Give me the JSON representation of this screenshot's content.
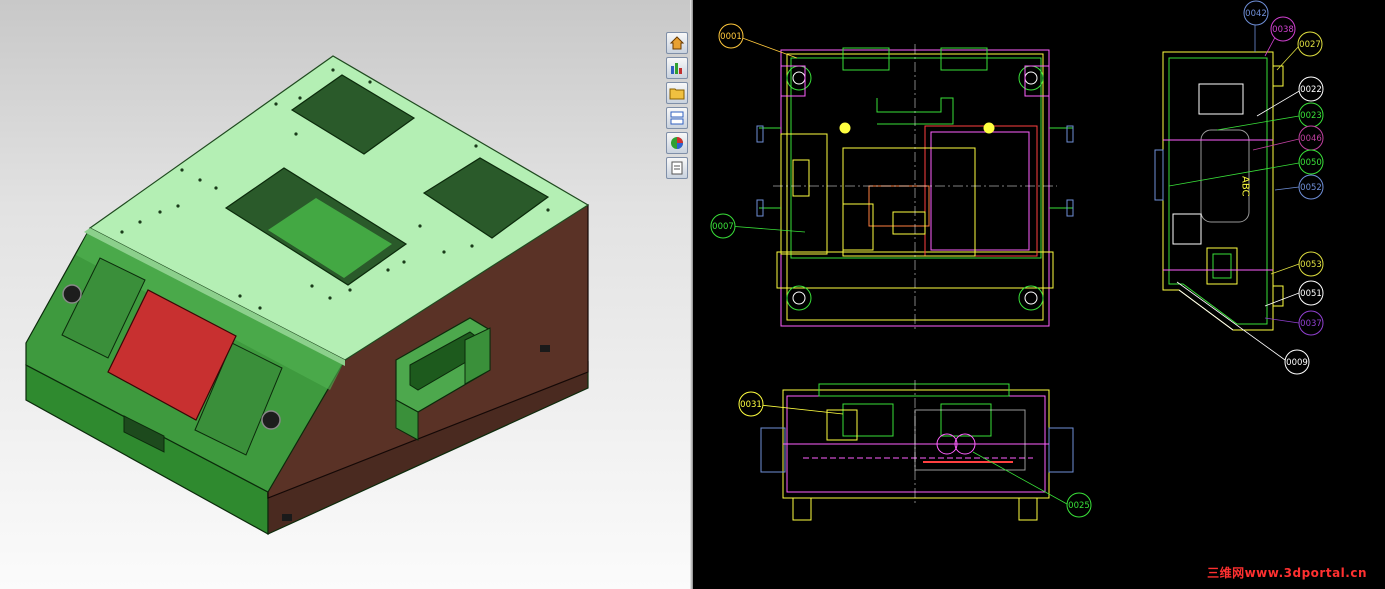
{
  "viewer": {
    "taskpane_buttons": [
      {
        "id": "home",
        "icon": "home-icon"
      },
      {
        "id": "design-library",
        "icon": "design-library-icon"
      },
      {
        "id": "file-explorer",
        "icon": "folder-icon"
      },
      {
        "id": "view-palette",
        "icon": "view-palette-icon"
      },
      {
        "id": "appearances",
        "icon": "appearances-icon"
      },
      {
        "id": "custom-properties",
        "icon": "custom-properties-icon"
      }
    ],
    "colors": {
      "top_plate": "#b4efb4",
      "side_wall": "#5a3226",
      "front_panel": "#3e9a3e",
      "display_window": "#c83030",
      "cad_background": "#000000"
    }
  },
  "drawing": {
    "balloons": [
      {
        "id": "b0001",
        "label": "0001",
        "color": "#ffc83c"
      },
      {
        "id": "b0007",
        "label": "0007",
        "color": "#39e039"
      },
      {
        "id": "b0031",
        "label": "0031",
        "color": "#ffff40"
      },
      {
        "id": "b0025",
        "label": "0025",
        "color": "#39e039"
      },
      {
        "id": "b0042",
        "label": "0042",
        "color": "#6f8fd8"
      },
      {
        "id": "b0038",
        "label": "0038",
        "color": "#d040d0"
      },
      {
        "id": "b0027",
        "label": "0027",
        "color": "#e0e040"
      },
      {
        "id": "b0022",
        "label": "0022",
        "color": "#ffffff"
      },
      {
        "id": "b0023",
        "label": "0023",
        "color": "#39e039"
      },
      {
        "id": "b0046",
        "label": "0046",
        "color": "#c040a0"
      },
      {
        "id": "b0050",
        "label": "0050",
        "color": "#39e039"
      },
      {
        "id": "b0052",
        "label": "0052",
        "color": "#6f8fd8"
      },
      {
        "id": "b0053",
        "label": "0053",
        "color": "#e0e040"
      },
      {
        "id": "b0051",
        "label": "0051",
        "color": "#ffffff"
      },
      {
        "id": "b0037",
        "label": "0037",
        "color": "#9040d0"
      },
      {
        "id": "b0009",
        "label": "0009",
        "color": "#ffffff"
      }
    ],
    "watermark": "三维网www.3dportal.cn"
  }
}
